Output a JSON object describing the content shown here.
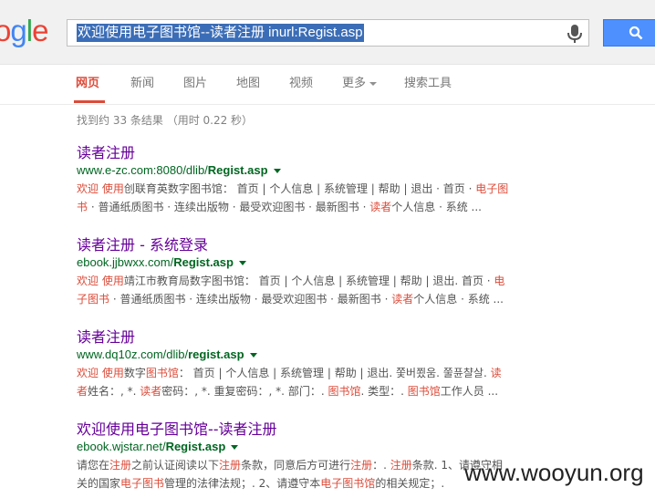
{
  "header": {
    "logo": [
      "o",
      "g",
      "l",
      "e"
    ],
    "logo_colors": [
      "#ea4335",
      "#4285f4",
      "#34a853",
      "#ea4335"
    ],
    "query": "欢迎使用电子图书馆--读者注册 inurl:Regist.asp"
  },
  "tabs": [
    {
      "label": "网页",
      "active": true
    },
    {
      "label": "新闻"
    },
    {
      "label": "图片"
    },
    {
      "label": "地图"
    },
    {
      "label": "视频"
    },
    {
      "label": "更多"
    },
    {
      "label": "搜索工具"
    }
  ],
  "stats": "找到约 33 条结果 （用时 0.22 秒）",
  "results": [
    {
      "title": "读者注册",
      "url_prefix": "www.e-zc.com:8080/dlib/",
      "url_bold": "Regist.asp",
      "snippet_lines": [
        [
          {
            "t": "欢迎 使用",
            "h": true
          },
          {
            "t": "创联育英数字图书馆： 首页 | 个人信息 | 系统管理 | 帮助 | 退出 · 首页 · "
          },
          {
            "t": "电子图",
            "h": true
          }
        ],
        [
          {
            "t": "书",
            "h": true
          },
          {
            "t": " · 普通纸质图书 · 连续出版物 · 最受欢迎图书 · 最新图书 · "
          },
          {
            "t": "读者",
            "h": true
          },
          {
            "t": "个人信息 · 系统 ..."
          }
        ]
      ]
    },
    {
      "title": "读者注册 - 系统登录",
      "url_prefix": "ebook.jjbwxx.com/",
      "url_bold": "Regist.asp",
      "snippet_lines": [
        [
          {
            "t": "欢迎 使用",
            "h": true
          },
          {
            "t": "靖江市教育局数字图书馆： 首页 | 个人信息 | 系统管理 | 帮助 | 退出. 首页 · "
          },
          {
            "t": "电",
            "h": true
          }
        ],
        [
          {
            "t": "子图书",
            "h": true
          },
          {
            "t": " · 普通纸质图书 · 连续出版物 · 最受欢迎图书 · 最新图书 · "
          },
          {
            "t": "读者",
            "h": true
          },
          {
            "t": "个人信息 · 系统 ..."
          }
        ]
      ]
    },
    {
      "title": "读者注册",
      "url_prefix": "www.dq10z.com/dlib/",
      "url_bold": "regist.asp",
      "snippet_lines": [
        [
          {
            "t": "欢迎 使用",
            "h": true
          },
          {
            "t": "数字"
          },
          {
            "t": "图书馆",
            "h": true
          },
          {
            "t": "： 首页 | 个人信息 | 系统管理 | 帮助 | 退出. 쫓버쬤움. 쭐퓬챨살. "
          },
          {
            "t": "读",
            "h": true
          }
        ],
        [
          {
            "t": "者",
            "h": true
          },
          {
            "t": "姓名：, *. "
          },
          {
            "t": "读者",
            "h": true
          },
          {
            "t": "密码：, *. 重复密码：, *. 部门：. "
          },
          {
            "t": "图书馆",
            "h": true
          },
          {
            "t": ". 类型：. "
          },
          {
            "t": "图书馆",
            "h": true
          },
          {
            "t": "工作人员 ..."
          }
        ]
      ]
    },
    {
      "title": "欢迎使用电子图书馆--读者注册",
      "url_prefix": "ebook.wjstar.net/",
      "url_bold": "Regist.asp",
      "snippet_lines": [
        [
          {
            "t": "请您在"
          },
          {
            "t": "注册",
            "h": true
          },
          {
            "t": "之前认证阅读以下"
          },
          {
            "t": "注册",
            "h": true
          },
          {
            "t": "条款，同意后方可进行"
          },
          {
            "t": "注册",
            "h": true
          },
          {
            "t": "：. "
          },
          {
            "t": "注册",
            "h": true
          },
          {
            "t": "条款. 1、请遵守相"
          }
        ],
        [
          {
            "t": "关的国家"
          },
          {
            "t": "电子图书",
            "h": true
          },
          {
            "t": "管理的法律法规；. 2、请遵守本"
          },
          {
            "t": "电子图书馆",
            "h": true
          },
          {
            "t": "的相关规定；."
          }
        ]
      ]
    }
  ],
  "watermark": "www.wooyun.org"
}
